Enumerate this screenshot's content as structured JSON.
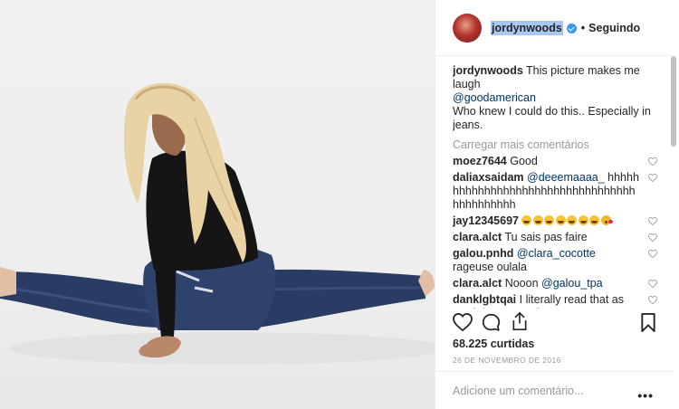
{
  "header": {
    "username": "jordynwoods",
    "verified": true,
    "separator": "•",
    "follow_label": "Seguindo"
  },
  "caption": {
    "username": "jordynwoods",
    "text_1": "This picture makes me laugh",
    "mention": "@goodamerican",
    "text_2": "Who knew I could do this.. Especially in jeans."
  },
  "load_more_label": "Carregar mais comentários",
  "comments": [
    {
      "user": "moez7644",
      "pre": "Good",
      "mention": "",
      "post": ""
    },
    {
      "user": "daliaxsaidam",
      "pre": "",
      "mention": "@deeemaaaa_",
      "post": " hhhhhhhhhhhhhhhhhhhhhhhhhhhhhhhhhhhhhhhhhhhh"
    },
    {
      "user": "jay12345697",
      "pre": "",
      "mention": "",
      "post": "",
      "emojis": [
        "face-with-tears-of-joy",
        "face-with-tears-of-joy",
        "face-with-tears-of-joy",
        "face-with-tears-of-joy",
        "face-with-tears-of-joy",
        "face-with-tears-of-joy",
        "face-with-tears-of-joy",
        "face-blowing-a-kiss"
      ]
    },
    {
      "user": "clara.alct",
      "pre": "Tu sais pas faire",
      "mention": "",
      "post": ""
    },
    {
      "user": "galou.pnhd",
      "pre": "",
      "mention": "@clara_cocotte",
      "post": " rageuse oulala"
    },
    {
      "user": "clara.alct",
      "pre": "Nooon ",
      "mention": "@galou_tpa",
      "post": ""
    },
    {
      "user": "danklgbtqai",
      "pre": "I literally read that as \"god damn America\"",
      "mention": "",
      "post": ""
    }
  ],
  "actions": {
    "like_icon": "heart-icon",
    "comment_icon": "comment-icon",
    "share_icon": "share-icon",
    "save_icon": "bookmark-icon"
  },
  "likes_label": "68.225 curtidas",
  "date_label": "26 DE NOVEMBRO DE 2016",
  "add_comment_placeholder": "Adicione um comentário...",
  "more_options_label": "•••",
  "colors": {
    "text": "#262626",
    "muted": "#999999",
    "mention": "#003569",
    "verified": "#3897f0",
    "border": "#efefef"
  }
}
